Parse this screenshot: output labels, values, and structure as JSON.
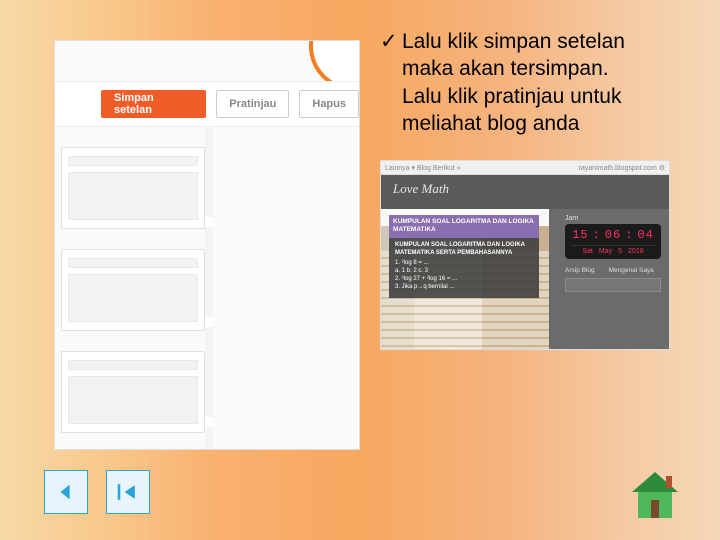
{
  "left": {
    "buttons": {
      "save": "Simpan setelan",
      "preview": "Pratinjau",
      "delete": "Hapus"
    }
  },
  "bullet": {
    "check": "✓",
    "line1": "Lalu klik simpan setelan",
    "line2": "maka akan tersimpan.",
    "line3": "Lalu klik pratinjau untuk",
    "line4": "meliahat blog anda"
  },
  "blog": {
    "bar_left": "Lainnya ▾  Blog Berikut »",
    "bar_right": "rayanimath.blogspot.com  ⚙",
    "title": "Love Math",
    "overlay_header": "KUMPULAN SOAL LOGARITMA DAN LOGIKA MATEMATIKA",
    "overlay_sub": "KUMPULAN SOAL LOGARITMA DAN LOGIKA MATEMATIKA SERTA PEMBAHASANNYA",
    "overlay_lines": "1. ²log 8 = ...\na. 1   b. 2   c. 3\n2. ³log 27 + ²log 16 = ...\n3. Jika p→q bernilai ...",
    "clock_label": "Jam",
    "time_h": "15",
    "time_m": "06",
    "time_s": "04",
    "day": "Sat",
    "month": "May",
    "dnum": "5",
    "year": "2018",
    "side1": "Arsip Blog",
    "side2": "Mengenai Saya"
  },
  "nav": {
    "back": "back-arrow",
    "first": "first-arrow",
    "home": "home"
  }
}
